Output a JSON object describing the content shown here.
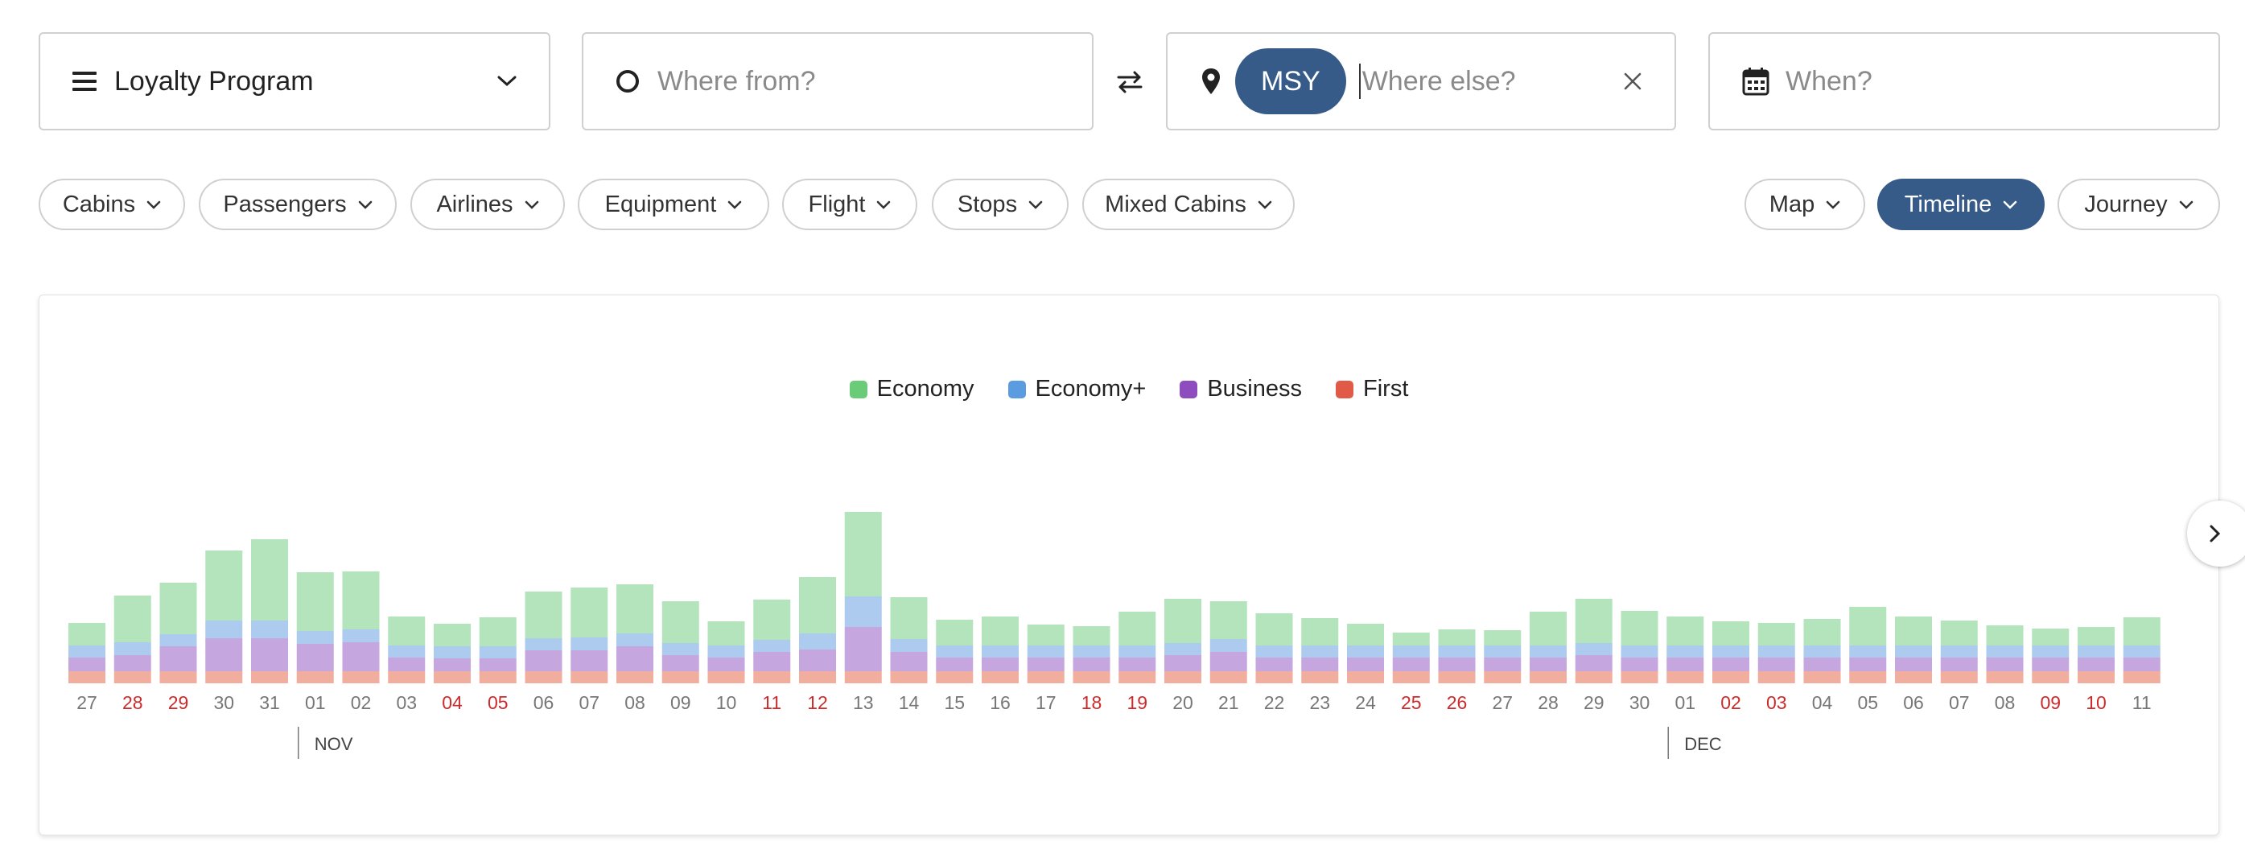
{
  "search": {
    "loyalty_label": "Loyalty Program",
    "from_placeholder": "Where from?",
    "to_chip": "MSY",
    "to_placeholder": "Where else?",
    "when_placeholder": "When?"
  },
  "filters": [
    {
      "label": "Cabins"
    },
    {
      "label": "Passengers"
    },
    {
      "label": "Airlines"
    },
    {
      "label": "Equipment"
    },
    {
      "label": "Flight"
    },
    {
      "label": "Stops"
    },
    {
      "label": "Mixed Cabins"
    }
  ],
  "views": [
    {
      "label": "Map",
      "active": false
    },
    {
      "label": "Timeline",
      "active": true
    },
    {
      "label": "Journey",
      "active": false
    }
  ],
  "colors": {
    "accent": "#365b89",
    "economy": "#6acb78",
    "economy_plus": "#5b9be0",
    "business": "#8e4dbe",
    "first": "#e05a47",
    "weekend_label": "#cc2b2b"
  },
  "chart_data": {
    "type": "bar",
    "stacked": true,
    "legend": [
      "Economy",
      "Economy+",
      "Business",
      "First"
    ],
    "legend_position": "top-center",
    "categories": [
      "27",
      "28",
      "29",
      "30",
      "31",
      "01",
      "02",
      "03",
      "04",
      "05",
      "06",
      "07",
      "08",
      "09",
      "10",
      "11",
      "12",
      "13",
      "14",
      "15",
      "16",
      "17",
      "18",
      "19",
      "20",
      "21",
      "22",
      "23",
      "24",
      "25",
      "26",
      "27",
      "28",
      "29",
      "30",
      "01",
      "02",
      "03",
      "04",
      "05",
      "06",
      "07",
      "08",
      "09",
      "10",
      "11"
    ],
    "weekend": [
      false,
      true,
      true,
      false,
      false,
      false,
      false,
      false,
      true,
      true,
      false,
      false,
      false,
      false,
      false,
      true,
      true,
      false,
      false,
      false,
      false,
      false,
      true,
      true,
      false,
      false,
      false,
      false,
      false,
      true,
      true,
      false,
      false,
      false,
      false,
      false,
      true,
      true,
      false,
      false,
      false,
      false,
      false,
      true,
      true,
      false
    ],
    "month_markers": [
      {
        "label": "NOV",
        "index": 5
      },
      {
        "label": "DEC",
        "index": 35
      }
    ],
    "series": [
      {
        "name": "First",
        "values": [
          15,
          15,
          15,
          15,
          15,
          15,
          15,
          15,
          15,
          15,
          15,
          15,
          15,
          15,
          15,
          15,
          15,
          15,
          15,
          15,
          15,
          15,
          15,
          15,
          15,
          15,
          15,
          15,
          15,
          15,
          15,
          15,
          15,
          15,
          15,
          15,
          15,
          15,
          15,
          15,
          15,
          15,
          15,
          15,
          15,
          15
        ]
      },
      {
        "name": "Business",
        "values": [
          17,
          20,
          31,
          41,
          41,
          34,
          36,
          17,
          16,
          16,
          26,
          26,
          31,
          20,
          17,
          24,
          27,
          55,
          24,
          17,
          17,
          17,
          17,
          17,
          20,
          24,
          17,
          17,
          17,
          17,
          17,
          17,
          17,
          20,
          17,
          17,
          17,
          17,
          17,
          17,
          17,
          17,
          17,
          17,
          17,
          17
        ]
      },
      {
        "name": "Economy+",
        "values": [
          15,
          16,
          15,
          22,
          22,
          16,
          16,
          15,
          15,
          15,
          15,
          16,
          16,
          15,
          15,
          15,
          20,
          38,
          16,
          15,
          15,
          15,
          15,
          15,
          15,
          16,
          15,
          15,
          15,
          15,
          15,
          15,
          15,
          15,
          15,
          15,
          15,
          15,
          15,
          15,
          15,
          15,
          15,
          15,
          15,
          15
        ]
      },
      {
        "name": "Economy",
        "values": [
          28,
          58,
          64,
          87,
          101,
          73,
          72,
          36,
          28,
          36,
          58,
          62,
          61,
          52,
          30,
          50,
          70,
          105,
          52,
          32,
          36,
          26,
          24,
          42,
          55,
          47,
          40,
          34,
          27,
          16,
          20,
          19,
          42,
          55,
          43,
          36,
          30,
          28,
          33,
          48,
          36,
          31,
          25,
          21,
          23,
          35
        ]
      }
    ]
  }
}
